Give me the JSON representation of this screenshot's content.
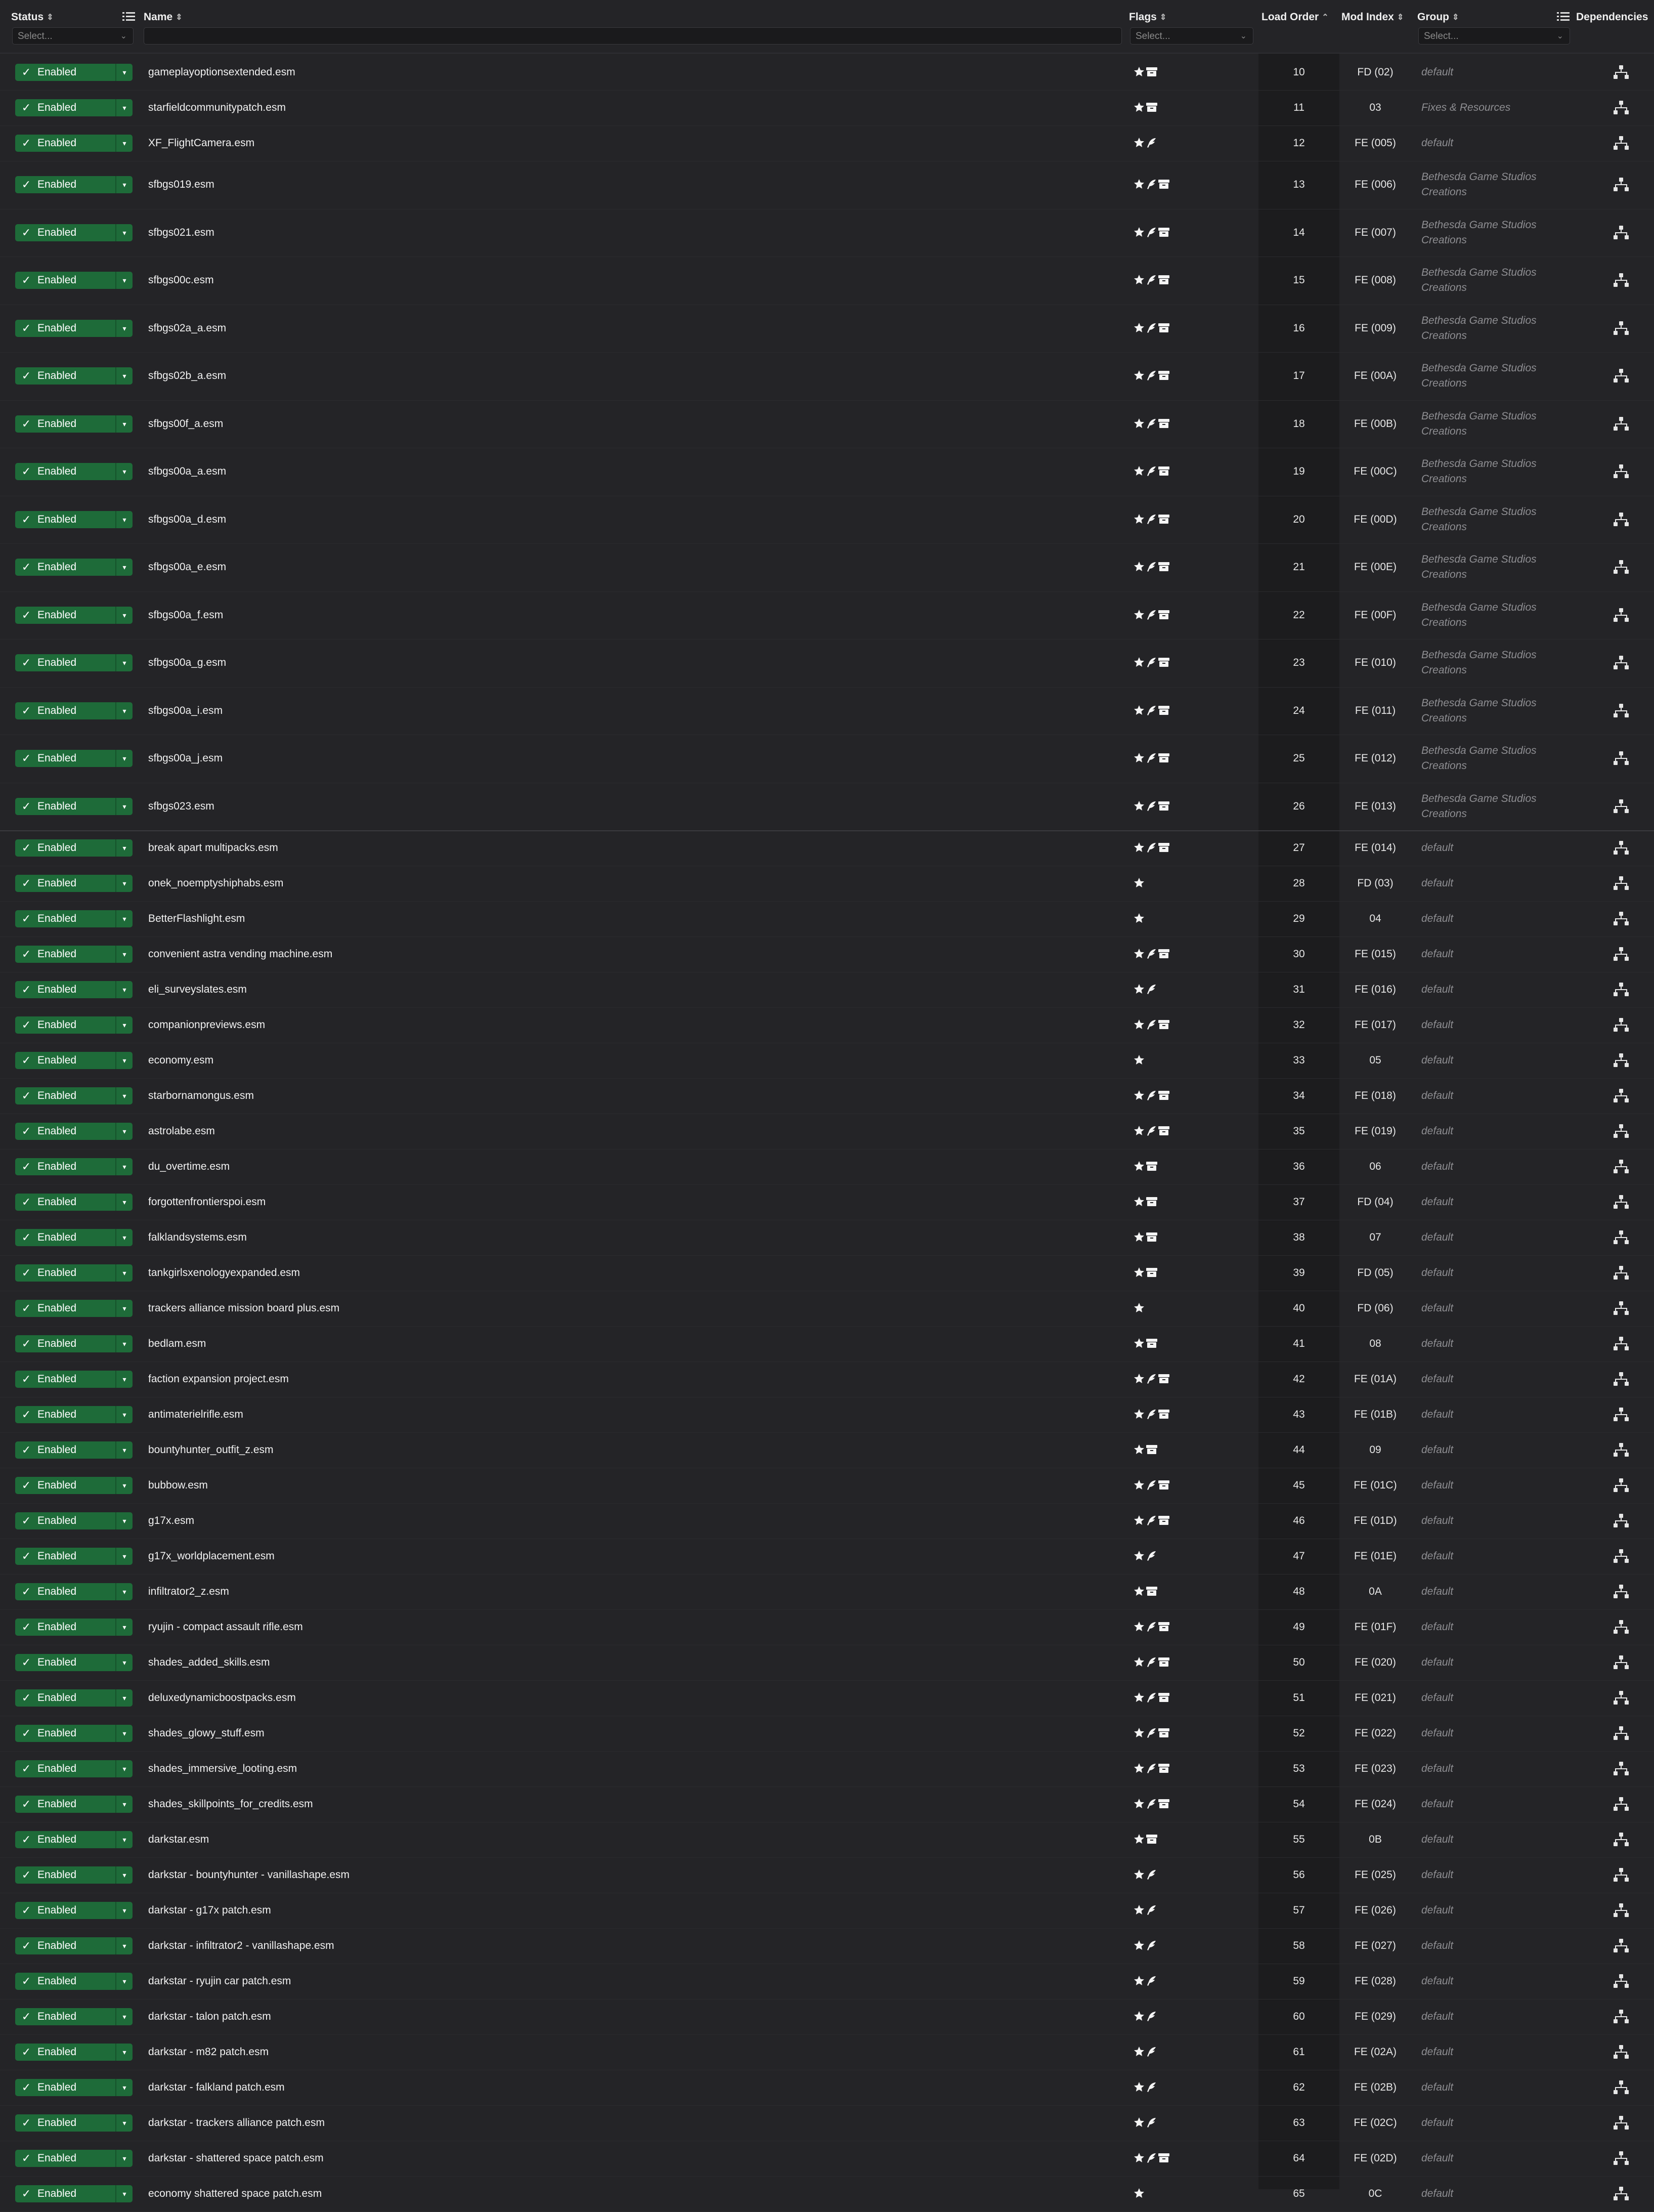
{
  "header": {
    "status": "Status",
    "name": "Name",
    "flags": "Flags",
    "load_order": "Load Order",
    "mod_index": "Mod Index",
    "group": "Group",
    "dependencies": "Dependencies",
    "status_filter_placeholder": "Select...",
    "flags_filter_placeholder": "Select...",
    "group_filter_placeholder": "Select..."
  },
  "status_label": "Enabled",
  "rows": [
    {
      "name": "gameplayoptionsextended.esm",
      "flags": "★▣",
      "load": "10",
      "index": "FD (02)",
      "group": "default"
    },
    {
      "name": "starfieldcommunitypatch.esm",
      "flags": "★▣",
      "load": "11",
      "index": "03",
      "group": "Fixes & Resources"
    },
    {
      "name": "XF_FlightCamera.esm",
      "flags": "★✒",
      "load": "12",
      "index": "FE (005)",
      "group": "default"
    },
    {
      "name": "sfbgs019.esm",
      "flags": "★✒▣",
      "load": "13",
      "index": "FE (006)",
      "group": "Bethesda Game Studios Creations"
    },
    {
      "name": "sfbgs021.esm",
      "flags": "★✒▣",
      "load": "14",
      "index": "FE (007)",
      "group": "Bethesda Game Studios Creations"
    },
    {
      "name": "sfbgs00c.esm",
      "flags": "★✒▣",
      "load": "15",
      "index": "FE (008)",
      "group": "Bethesda Game Studios Creations"
    },
    {
      "name": "sfbgs02a_a.esm",
      "flags": "★✒▣",
      "load": "16",
      "index": "FE (009)",
      "group": "Bethesda Game Studios Creations"
    },
    {
      "name": "sfbgs02b_a.esm",
      "flags": "★✒▣",
      "load": "17",
      "index": "FE (00A)",
      "group": "Bethesda Game Studios Creations"
    },
    {
      "name": "sfbgs00f_a.esm",
      "flags": "★✒▣",
      "load": "18",
      "index": "FE (00B)",
      "group": "Bethesda Game Studios Creations"
    },
    {
      "name": "sfbgs00a_a.esm",
      "flags": "★✒▣",
      "load": "19",
      "index": "FE (00C)",
      "group": "Bethesda Game Studios Creations"
    },
    {
      "name": "sfbgs00a_d.esm",
      "flags": "★✒▣",
      "load": "20",
      "index": "FE (00D)",
      "group": "Bethesda Game Studios Creations"
    },
    {
      "name": "sfbgs00a_e.esm",
      "flags": "★✒▣",
      "load": "21",
      "index": "FE (00E)",
      "group": "Bethesda Game Studios Creations"
    },
    {
      "name": "sfbgs00a_f.esm",
      "flags": "★✒▣",
      "load": "22",
      "index": "FE (00F)",
      "group": "Bethesda Game Studios Creations"
    },
    {
      "name": "sfbgs00a_g.esm",
      "flags": "★✒▣",
      "load": "23",
      "index": "FE (010)",
      "group": "Bethesda Game Studios Creations"
    },
    {
      "name": "sfbgs00a_i.esm",
      "flags": "★✒▣",
      "load": "24",
      "index": "FE (011)",
      "group": "Bethesda Game Studios Creations"
    },
    {
      "name": "sfbgs00a_j.esm",
      "flags": "★✒▣",
      "load": "25",
      "index": "FE (012)",
      "group": "Bethesda Game Studios Creations"
    },
    {
      "name": "sfbgs023.esm",
      "flags": "★✒▣",
      "load": "26",
      "index": "FE (013)",
      "group": "Bethesda Game Studios Creations"
    },
    {
      "name": "break apart multipacks.esm",
      "flags": "★✒▣",
      "load": "27",
      "index": "FE (014)",
      "group": "default"
    },
    {
      "name": "onek_noemptyshiphabs.esm",
      "flags": "★",
      "load": "28",
      "index": "FD (03)",
      "group": "default"
    },
    {
      "name": "BetterFlashlight.esm",
      "flags": "★",
      "load": "29",
      "index": "04",
      "group": "default"
    },
    {
      "name": "convenient astra vending machine.esm",
      "flags": "★✒▣",
      "load": "30",
      "index": "FE (015)",
      "group": "default"
    },
    {
      "name": "eli_surveyslates.esm",
      "flags": "★✒",
      "load": "31",
      "index": "FE (016)",
      "group": "default"
    },
    {
      "name": "companionpreviews.esm",
      "flags": "★✒▣",
      "load": "32",
      "index": "FE (017)",
      "group": "default"
    },
    {
      "name": "economy.esm",
      "flags": "★",
      "load": "33",
      "index": "05",
      "group": "default"
    },
    {
      "name": "starbornamongus.esm",
      "flags": "★✒▣",
      "load": "34",
      "index": "FE (018)",
      "group": "default"
    },
    {
      "name": "astrolabe.esm",
      "flags": "★✒▣",
      "load": "35",
      "index": "FE (019)",
      "group": "default"
    },
    {
      "name": "du_overtime.esm",
      "flags": "★▣",
      "load": "36",
      "index": "06",
      "group": "default"
    },
    {
      "name": "forgottenfrontierspoi.esm",
      "flags": "★▣",
      "load": "37",
      "index": "FD (04)",
      "group": "default"
    },
    {
      "name": "falklandsystems.esm",
      "flags": "★▣",
      "load": "38",
      "index": "07",
      "group": "default"
    },
    {
      "name": "tankgirlsxenologyexpanded.esm",
      "flags": "★▣",
      "load": "39",
      "index": "FD (05)",
      "group": "default"
    },
    {
      "name": "trackers alliance mission board plus.esm",
      "flags": "★",
      "load": "40",
      "index": "FD (06)",
      "group": "default"
    },
    {
      "name": "bedlam.esm",
      "flags": "★▣",
      "load": "41",
      "index": "08",
      "group": "default"
    },
    {
      "name": "faction expansion project.esm",
      "flags": "★✒▣",
      "load": "42",
      "index": "FE (01A)",
      "group": "default"
    },
    {
      "name": "antimaterielrifle.esm",
      "flags": "★✒▣",
      "load": "43",
      "index": "FE (01B)",
      "group": "default"
    },
    {
      "name": "bountyhunter_outfit_z.esm",
      "flags": "★▣",
      "load": "44",
      "index": "09",
      "group": "default"
    },
    {
      "name": "bubbow.esm",
      "flags": "★✒▣",
      "load": "45",
      "index": "FE (01C)",
      "group": "default"
    },
    {
      "name": "g17x.esm",
      "flags": "★✒▣",
      "load": "46",
      "index": "FE (01D)",
      "group": "default"
    },
    {
      "name": "g17x_worldplacement.esm",
      "flags": "★✒",
      "load": "47",
      "index": "FE (01E)",
      "group": "default"
    },
    {
      "name": "infiltrator2_z.esm",
      "flags": "★▣",
      "load": "48",
      "index": "0A",
      "group": "default"
    },
    {
      "name": "ryujin - compact assault rifle.esm",
      "flags": "★✒▣",
      "load": "49",
      "index": "FE (01F)",
      "group": "default"
    },
    {
      "name": "shades_added_skills.esm",
      "flags": "★✒▣",
      "load": "50",
      "index": "FE (020)",
      "group": "default"
    },
    {
      "name": "deluxedynamicboostpacks.esm",
      "flags": "★✒▣",
      "load": "51",
      "index": "FE (021)",
      "group": "default"
    },
    {
      "name": "shades_glowy_stuff.esm",
      "flags": "★✒▣",
      "load": "52",
      "index": "FE (022)",
      "group": "default"
    },
    {
      "name": "shades_immersive_looting.esm",
      "flags": "★✒▣",
      "load": "53",
      "index": "FE (023)",
      "group": "default"
    },
    {
      "name": "shades_skillpoints_for_credits.esm",
      "flags": "★✒▣",
      "load": "54",
      "index": "FE (024)",
      "group": "default"
    },
    {
      "name": "darkstar.esm",
      "flags": "★▣",
      "load": "55",
      "index": "0B",
      "group": "default"
    },
    {
      "name": "darkstar - bountyhunter - vanillashape.esm",
      "flags": "★✒",
      "load": "56",
      "index": "FE (025)",
      "group": "default"
    },
    {
      "name": "darkstar - g17x patch.esm",
      "flags": "★✒",
      "load": "57",
      "index": "FE (026)",
      "group": "default"
    },
    {
      "name": "darkstar - infiltrator2 - vanillashape.esm",
      "flags": "★✒",
      "load": "58",
      "index": "FE (027)",
      "group": "default"
    },
    {
      "name": "darkstar - ryujin car patch.esm",
      "flags": "★✒",
      "load": "59",
      "index": "FE (028)",
      "group": "default"
    },
    {
      "name": "darkstar - talon patch.esm",
      "flags": "★✒",
      "load": "60",
      "index": "FE (029)",
      "group": "default"
    },
    {
      "name": "darkstar - m82 patch.esm",
      "flags": "★✒",
      "load": "61",
      "index": "FE (02A)",
      "group": "default"
    },
    {
      "name": "darkstar - falkland patch.esm",
      "flags": "★✒",
      "load": "62",
      "index": "FE (02B)",
      "group": "default"
    },
    {
      "name": "darkstar - trackers alliance patch.esm",
      "flags": "★✒",
      "load": "63",
      "index": "FE (02C)",
      "group": "default"
    },
    {
      "name": "darkstar - shattered space patch.esm",
      "flags": "★✒▣",
      "load": "64",
      "index": "FE (02D)",
      "group": "default"
    },
    {
      "name": "economy shattered space patch.esm",
      "flags": "★",
      "load": "65",
      "index": "0C",
      "group": "default"
    }
  ]
}
